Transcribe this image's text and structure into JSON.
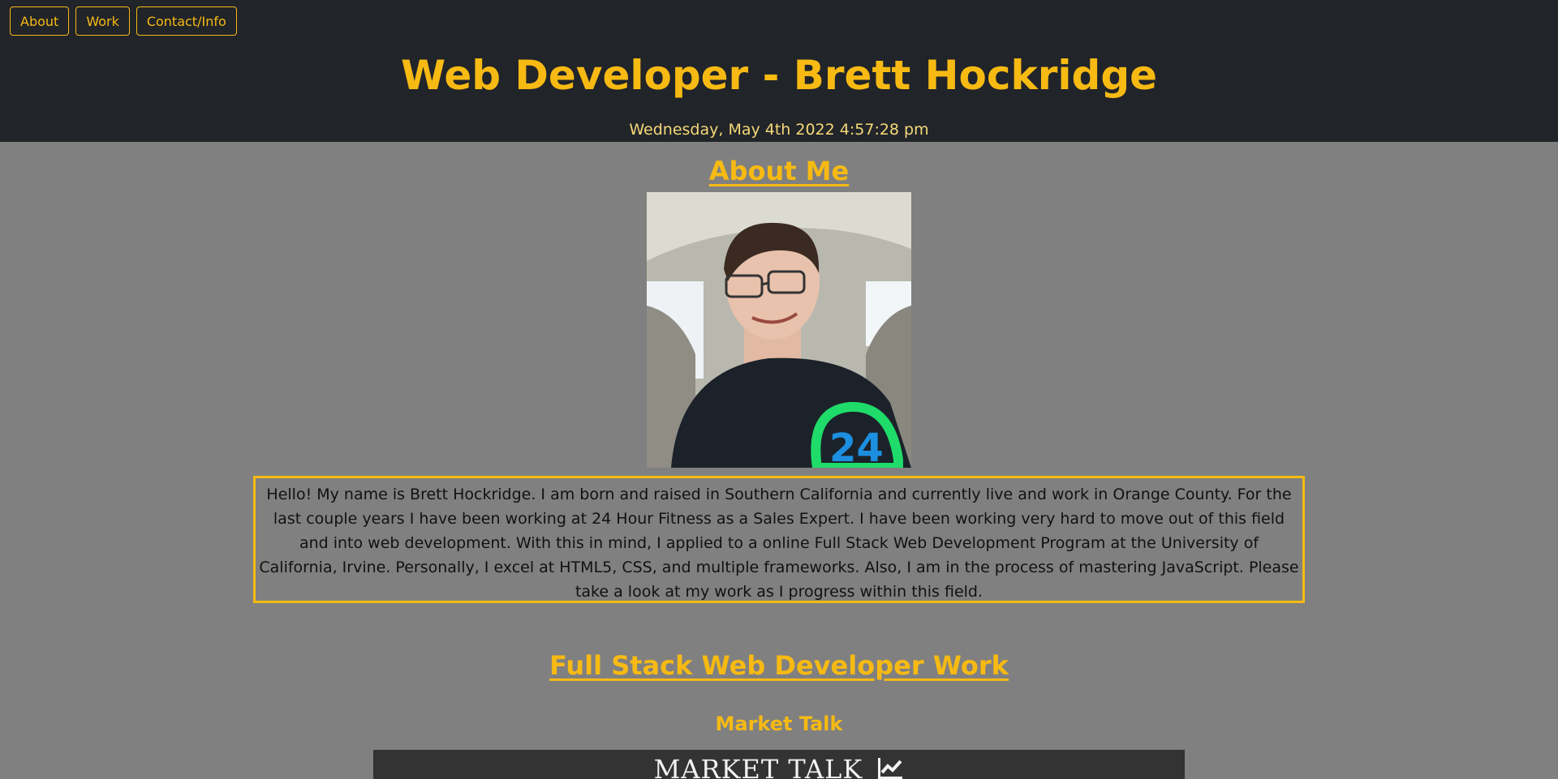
{
  "nav": {
    "items": [
      {
        "label": "About"
      },
      {
        "label": "Work"
      },
      {
        "label": "Contact/Info"
      }
    ]
  },
  "header": {
    "title": "Web Developer - Brett Hockridge",
    "datetime": "Wednesday, May 4th 2022 4:57:28 pm"
  },
  "about": {
    "heading": "About Me",
    "bio": "Hello! My name is Brett Hockridge. I am born and raised in Southern California and currently live and work in Orange County. For the last couple years I have been working at 24 Hour Fitness as a Sales Expert. I have been working very hard to move out of this field and into web development. With this in mind, I applied to a online Full Stack Web Development Program at the University of California, Irvine. Personally, I excel at HTML5, CSS, and multiple frameworks. Also, I am in the process of mastering JavaScript. Please take a look at my work as I progress within this field."
  },
  "work": {
    "heading": "Full Stack Web Developer Work",
    "projects": [
      {
        "title": "Market Talk",
        "logo_text": "MARKET TALK",
        "icon": "chart-line-icon"
      }
    ]
  },
  "colors": {
    "accent": "#f7ba13",
    "header_bg": "#212429",
    "page_bg": "#808080"
  }
}
